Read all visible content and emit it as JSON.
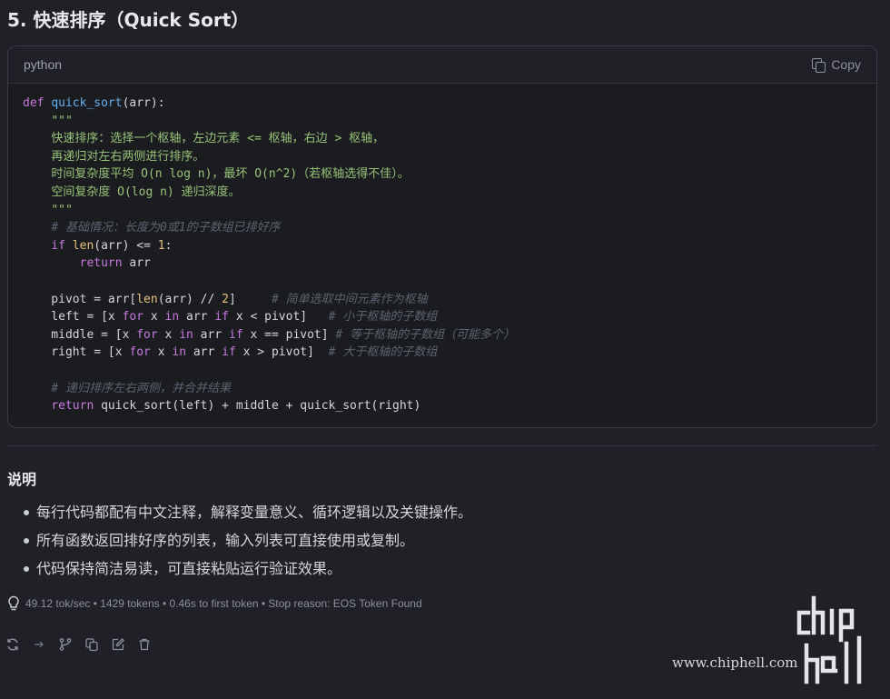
{
  "heading": "5. 快速排序（Quick Sort）",
  "code_block": {
    "language": "python",
    "copy_label": "Copy",
    "copy_icon": "copy-icon"
  },
  "notes": {
    "title": "说明",
    "items": [
      "每行代码都配有中文注释，解释变量意义、循环逻辑以及关键操作。",
      "所有函数返回排好序的列表，输入列表可直接使用或复制。",
      "代码保持简洁易读，可直接粘贴运行验证效果。"
    ]
  },
  "stats": {
    "icon": "lightbulb-icon",
    "text": "49.12 tok/sec • 1429 tokens • 0.46s to first token • Stop reason: EOS Token Found"
  },
  "actions": [
    "regenerate-icon",
    "continue-icon",
    "branch-icon",
    "copy-icon",
    "edit-icon",
    "delete-icon"
  ],
  "watermark": {
    "url": "www.chiphell.com",
    "logo": "chiphell-logo"
  },
  "colors": {
    "background": "#1f2126",
    "code_background": "#1a1c20",
    "keyword": "#c678dd",
    "function": "#61afef",
    "string": "#98c379",
    "number": "#e5c07b",
    "comment": "#5c6370"
  }
}
